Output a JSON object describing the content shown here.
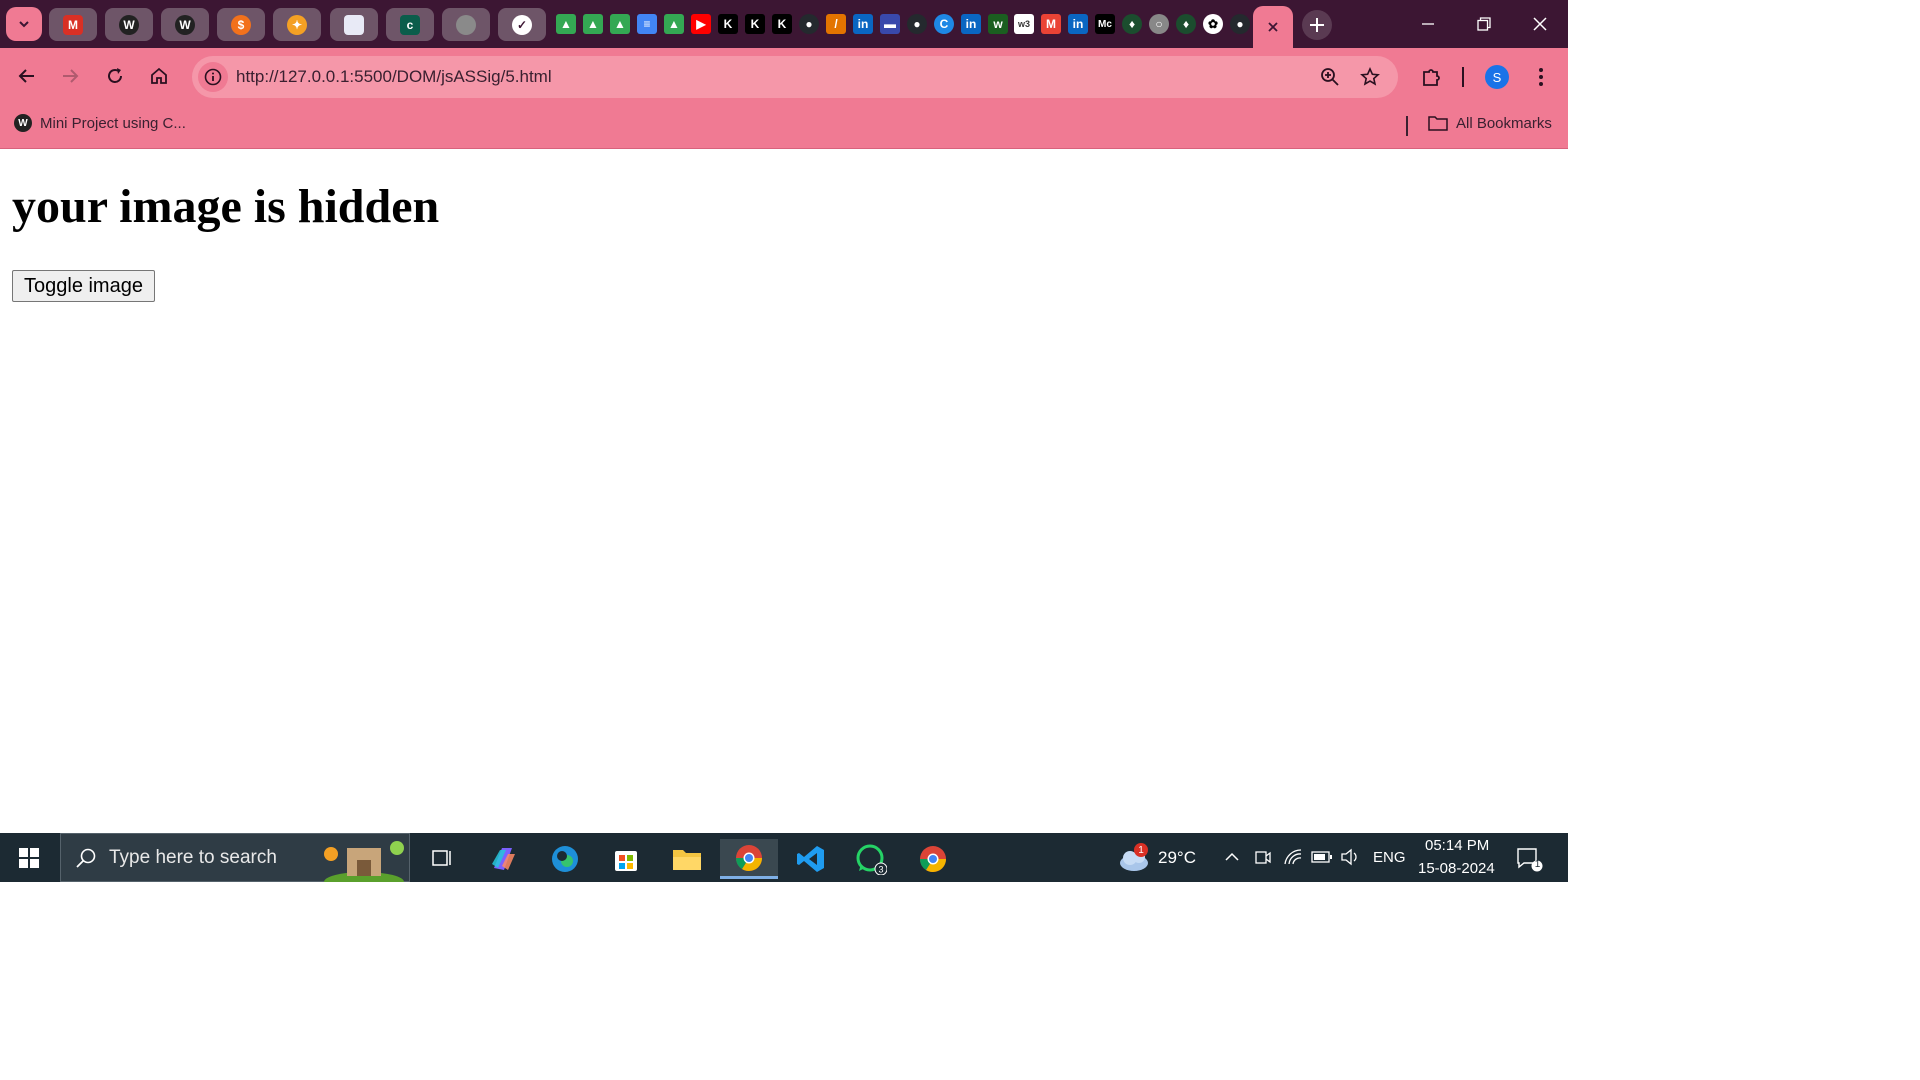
{
  "browser": {
    "url": "http://127.0.0.1:5500/DOM/jsASSig/5.html",
    "profile_initial": "S",
    "bookmarks": [
      {
        "label": "Mini Project using C..."
      }
    ],
    "all_bookmarks_label": "All Bookmarks",
    "tab_favicons": [
      "M",
      "K",
      "K",
      "K",
      "in",
      "in",
      "in",
      "w3",
      "Mc"
    ]
  },
  "page": {
    "heading": "your image is hidden",
    "toggle_button": "Toggle image"
  },
  "taskbar": {
    "search_placeholder": "Type here to search",
    "weather_temp": "29°C",
    "weather_badge": "1",
    "language": "ENG",
    "time": "05:14 PM",
    "date": "15-08-2024",
    "whatsapp_badge": "3",
    "notification_count": "1"
  },
  "colors": {
    "tabstrip": "#3c1633",
    "toolbar": "#f07a93",
    "taskbar": "#1c2a33"
  }
}
